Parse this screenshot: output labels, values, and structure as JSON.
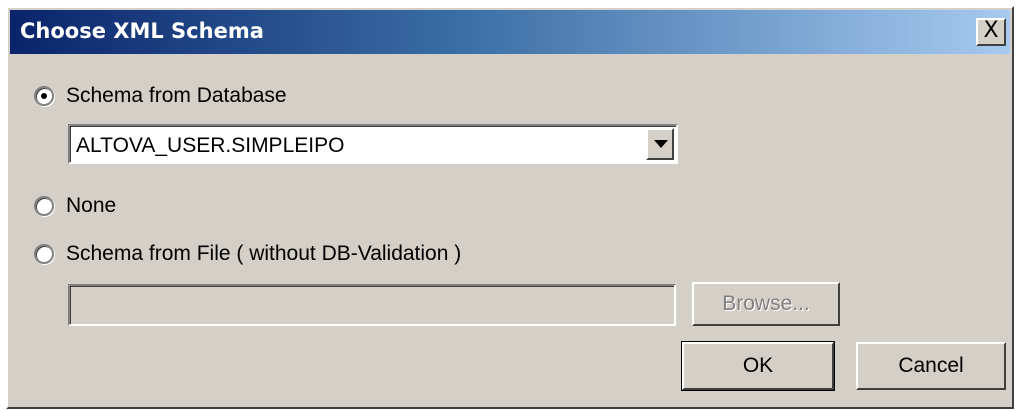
{
  "dialog": {
    "title": "Choose XML Schema",
    "close_glyph": "X"
  },
  "options": {
    "schema_from_database": {
      "label": "Schema from Database",
      "selected": true
    },
    "none": {
      "label": "None",
      "selected": false
    },
    "schema_from_file": {
      "label": "Schema from File ( without DB-Validation )",
      "selected": false
    }
  },
  "database_schema_select": {
    "value": "ALTOVA_USER.SIMPLEIPO"
  },
  "file_path_input": {
    "value": "",
    "disabled": true
  },
  "buttons": {
    "browse": "Browse...",
    "ok": "OK",
    "cancel": "Cancel"
  },
  "icons": {
    "close": "close-icon",
    "dropdown": "chevron-down-icon"
  },
  "colors": {
    "titlebar_start": "#0a246a",
    "titlebar_end": "#a6caf0",
    "dialog_bg": "#d4d0c8"
  }
}
